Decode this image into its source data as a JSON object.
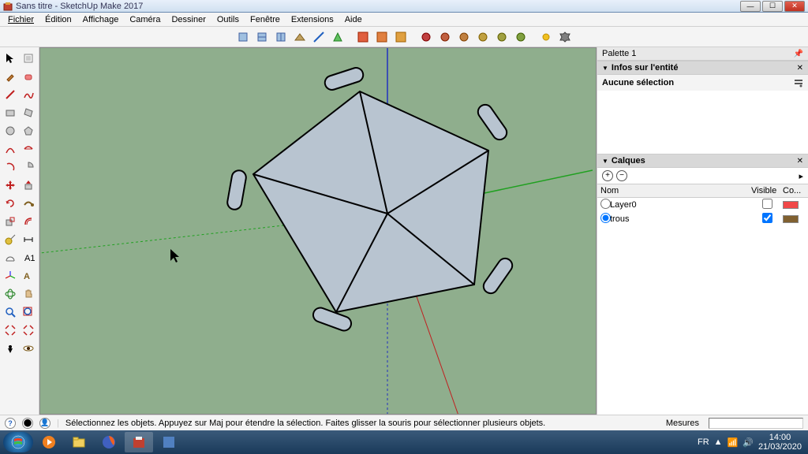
{
  "window": {
    "title": "Sans titre - SketchUp Make 2017"
  },
  "menu": [
    "Fichier",
    "Édition",
    "Affichage",
    "Caméra",
    "Dessiner",
    "Outils",
    "Fenêtre",
    "Extensions",
    "Aide"
  ],
  "palette": {
    "title": "Palette 1",
    "entity_hdr": "Infos sur l'entité",
    "entity_sel": "Aucune sélection",
    "layers_hdr": "Calques",
    "layers_cols": {
      "name": "Nom",
      "visible": "Visible",
      "color": "Co..."
    },
    "layers": [
      {
        "name": "Layer0",
        "visible": false,
        "color": "#f04848",
        "active": false
      },
      {
        "name": "trous",
        "visible": true,
        "color": "#806030",
        "active": true
      }
    ]
  },
  "status": {
    "hint": "Sélectionnez les objets. Appuyez sur Maj pour étendre la sélection. Faites glisser la souris pour sélectionner plusieurs objets.",
    "measure_label": "Mesures"
  },
  "tray": {
    "lang": "FR",
    "time": "14:00",
    "date": "21/03/2020"
  }
}
